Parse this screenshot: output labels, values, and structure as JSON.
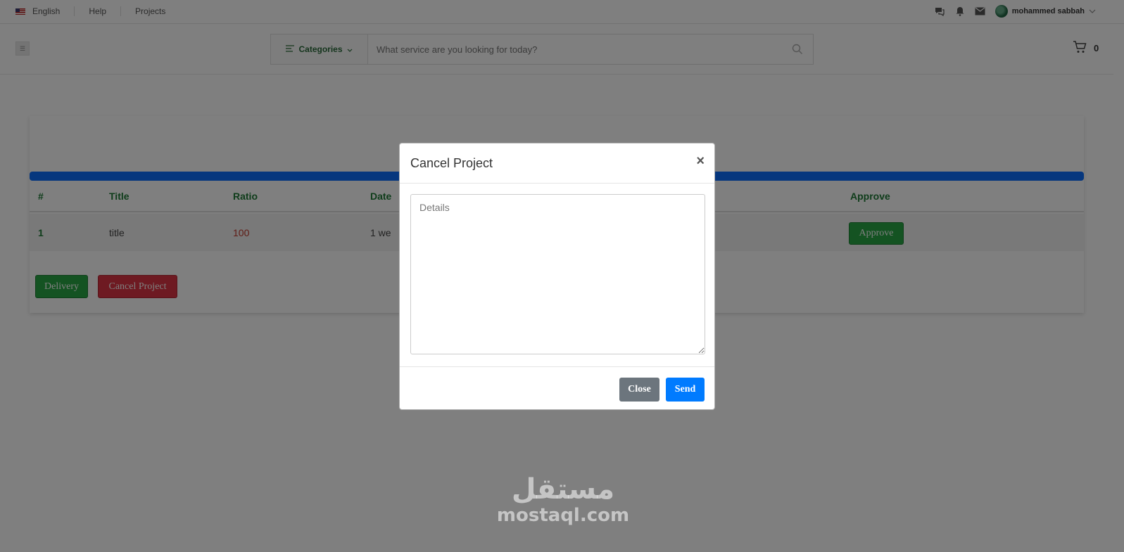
{
  "topbar": {
    "language": "English",
    "help": "Help",
    "projects": "Projects",
    "user_name": "mohammed sabbah"
  },
  "header": {
    "categories_label": "Categories",
    "search_placeholder": "What service are you looking for today?",
    "cart_count": "0"
  },
  "table": {
    "headers": {
      "num": "#",
      "title": "Title",
      "ratio": "Ratio",
      "date": "Date",
      "approve": "Approve"
    },
    "rows": [
      {
        "num": "1",
        "title": "title",
        "ratio": "100",
        "date": "1 we",
        "approve_label": "Approve"
      }
    ]
  },
  "actions": {
    "delivery_label": "Delivery",
    "cancel_label": "Cancel Project"
  },
  "modal": {
    "title": "Cancel Project",
    "close_x": "×",
    "details_placeholder": "Details",
    "close_label": "Close",
    "send_label": "Send"
  },
  "watermark": {
    "arabic": "مستقل",
    "latin": "mostaql.com"
  },
  "colors": {
    "progress": "#0d6efd",
    "success": "#28a745",
    "danger": "#dc3545",
    "primary": "#007bff",
    "secondary": "#6c757d"
  }
}
